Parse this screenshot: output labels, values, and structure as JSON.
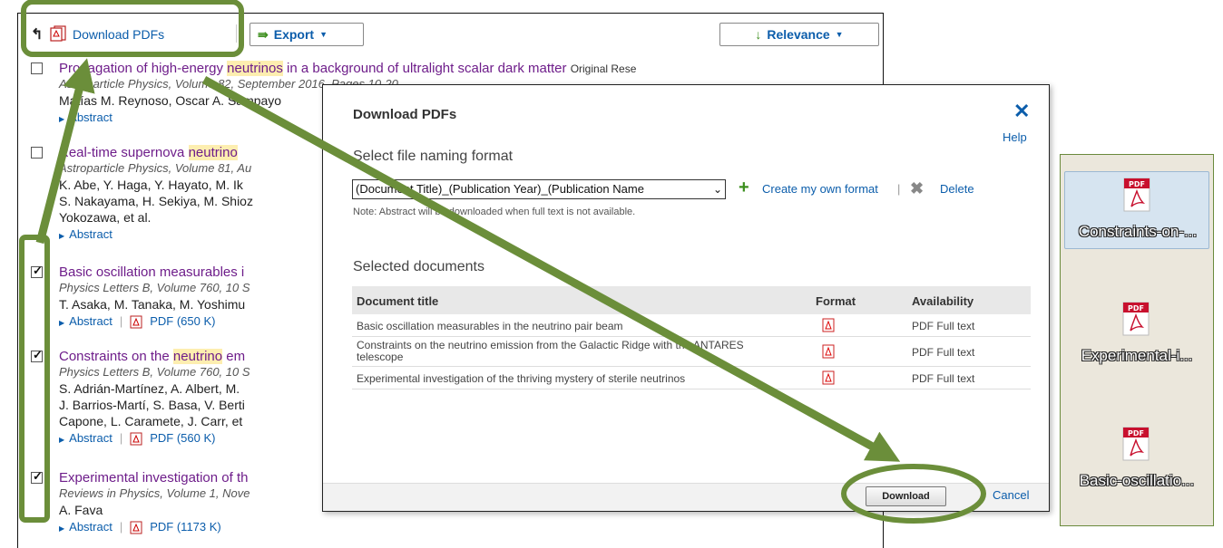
{
  "toolbar": {
    "download_pdfs": "Download PDFs",
    "export": "Export",
    "relevance": "Relevance"
  },
  "results": [
    {
      "checked": false,
      "title_pre": "Propagation of high-energy ",
      "title_hl": "neutrinos",
      "title_post": " in a background of ultralight scalar dark matter",
      "type": "Original Rese",
      "source": "Astroparticle Physics, Volume 82, September 2016, Pages 10-20",
      "authors": [
        "Matías M. Reynoso, Oscar A. Sampayo"
      ],
      "links": [
        "Abstract"
      ]
    },
    {
      "checked": false,
      "title_pre": "Real-time supernova ",
      "title_hl": "neutrino",
      "title_post": "",
      "type": "",
      "source": "Astroparticle Physics, Volume 81, Au",
      "authors": [
        "K. Abe, Y. Haga, Y. Hayato, M. Ik",
        "S. Nakayama, H. Sekiya, M. Shioz",
        "Yokozawa, et al."
      ],
      "links": [
        "Abstract"
      ]
    },
    {
      "checked": true,
      "title_pre": "Basic oscillation measurables i",
      "title_hl": "",
      "title_post": "",
      "type": "",
      "source": "Physics Letters B, Volume 760, 10 S",
      "authors": [
        "T. Asaka, M. Tanaka, M. Yoshimu"
      ],
      "links": [
        "Abstract",
        "PDF (650 K)"
      ]
    },
    {
      "checked": true,
      "title_pre": "Constraints on the ",
      "title_hl": "neutrino",
      "title_post": " em",
      "type": "",
      "source": "Physics Letters B, Volume 760, 10 S",
      "authors": [
        "S. Adrián-Martínez, A. Albert, M.",
        "J. Barrios-Martí, S. Basa, V. Berti",
        "Capone, L. Caramete, J. Carr, et"
      ],
      "links": [
        "Abstract",
        "PDF (560 K)"
      ]
    },
    {
      "checked": true,
      "title_pre": "Experimental investigation of th",
      "title_hl": "",
      "title_post": "",
      "type": "",
      "source": "Reviews in Physics, Volume 1, Nove",
      "authors": [
        "A. Fava"
      ],
      "links": [
        "Abstract",
        "PDF (1173 K)"
      ]
    }
  ],
  "dialog": {
    "title": "Download PDFs",
    "help": "Help",
    "naming_heading": "Select file naming format",
    "naming_value": "(Document Title)_(Publication Year)_(Publication Name",
    "create_format": "Create my own format",
    "delete": "Delete",
    "note": "Note: Abstract will be downloaded when full text is not available.",
    "selected_heading": "Selected documents",
    "col_title": "Document title",
    "col_format": "Format",
    "col_availability": "Availability",
    "rows": [
      {
        "title": "Basic oscillation measurables in the neutrino pair beam",
        "availability": "PDF Full text"
      },
      {
        "title": "Constraints on the neutrino emission from the Galactic Ridge with the ANTARES telescope",
        "availability": "PDF Full text"
      },
      {
        "title": "Experimental investigation of the thriving mystery of sterile neutrinos",
        "availability": "PDF Full text"
      }
    ],
    "download": "Download",
    "cancel": "Cancel"
  },
  "files": [
    {
      "name": "Constraints-on-...",
      "selected": true
    },
    {
      "name": "Experimental-i...",
      "selected": false
    },
    {
      "name": "Basic-oscillatio...",
      "selected": false
    }
  ],
  "colors": {
    "annotation": "#6b8e3a",
    "link": "#0b5dab",
    "title": "#6e1d8a",
    "highlight": "#fdeeb0"
  }
}
